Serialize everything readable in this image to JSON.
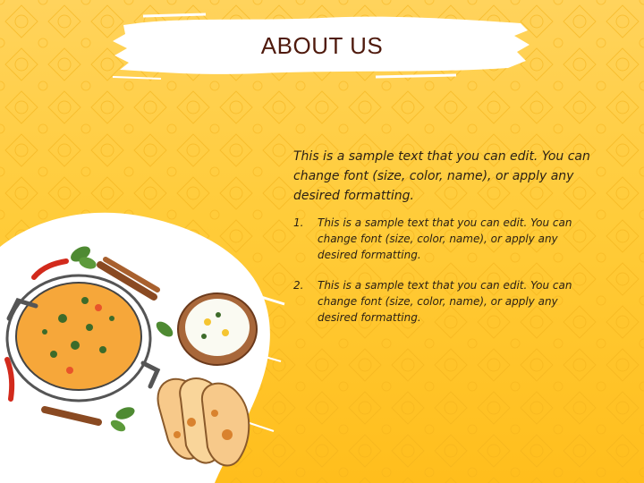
{
  "slide": {
    "title": "ABOUT US",
    "intro": "This is a sample text that you can edit. You can change font (size, color, name), or apply any desired formatting.",
    "list": [
      {
        "number": "1.",
        "text": "This is a sample text that you can edit. You can change font (size, color, name), or apply any desired formatting."
      },
      {
        "number": "2.",
        "text": "This is a sample text that you can edit. You can change font (size, color, name), or apply any desired formatting."
      }
    ]
  },
  "colors": {
    "background": "#ffc42e",
    "title_text": "#4f1a0d",
    "body_text": "#2a1f14",
    "brush": "#ffffff"
  },
  "icons": [
    "curry-pan-icon",
    "rice-bowl-icon",
    "flatbread-icon",
    "cinnamon-stick-icon",
    "chili-pepper-icon",
    "herb-leaf-icon"
  ]
}
